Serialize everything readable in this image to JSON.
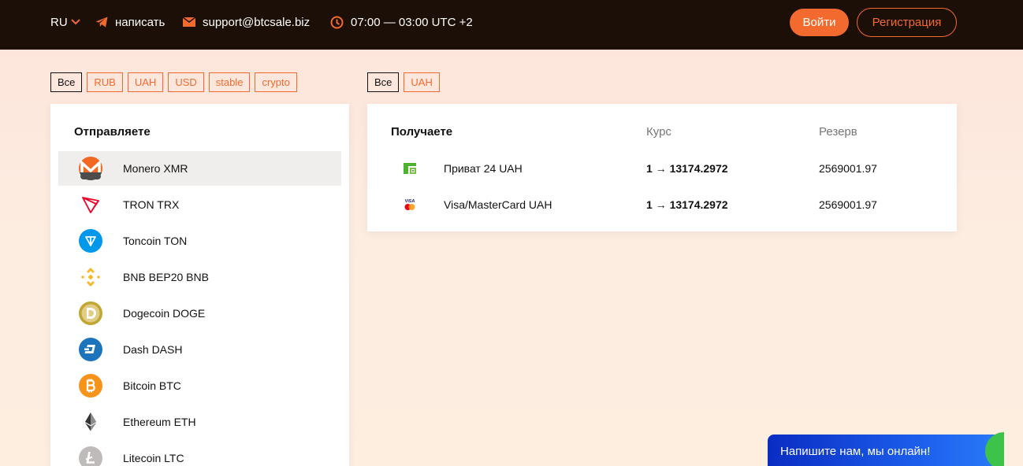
{
  "header": {
    "lang": "RU",
    "write_label": "написать",
    "email": "support@btcsale.biz",
    "hours": "07:00 — 03:00 UTC +2",
    "login_label": "Войти",
    "register_label": "Регистрация"
  },
  "send_filters": [
    "Все",
    "RUB",
    "UAH",
    "USD",
    "stable",
    "crypto"
  ],
  "recv_filters": [
    "Все",
    "UAH"
  ],
  "send_panel": {
    "title": "Отправляете",
    "coins": [
      {
        "label": "Monero XMR",
        "icon": "monero-icon",
        "color": "#f26822"
      },
      {
        "label": "TRON TRX",
        "icon": "tron-icon",
        "color": "#eb0029"
      },
      {
        "label": "Toncoin TON",
        "icon": "toncoin-icon",
        "color": "#0098ea"
      },
      {
        "label": "BNB BEP20 BNB",
        "icon": "bnb-icon",
        "color": "#f3ba2f"
      },
      {
        "label": "Dogecoin DOGE",
        "icon": "dogecoin-icon",
        "color": "#c2a633"
      },
      {
        "label": "Dash DASH",
        "icon": "dash-icon",
        "color": "#1c75bc"
      },
      {
        "label": "Bitcoin BTC",
        "icon": "bitcoin-icon",
        "color": "#f7931a"
      },
      {
        "label": "Ethereum ETH",
        "icon": "ethereum-icon",
        "color": "#343434"
      },
      {
        "label": "Litecoin LTC",
        "icon": "litecoin-icon",
        "color": "#bfbbbb"
      }
    ]
  },
  "recv_panel": {
    "title": "Получаете",
    "col_rate": "Курс",
    "col_reserve": "Резерв",
    "rows": [
      {
        "name": "Приват 24 UAH",
        "icon": "privat24-icon",
        "rate": "1 → 13174.2972",
        "reserve": "2569001.97"
      },
      {
        "name": "Visa/MasterCard UAH",
        "icon": "visa-mastercard-icon",
        "rate": "1 → 13174.2972",
        "reserve": "2569001.97"
      }
    ]
  },
  "chat": {
    "text": "Напишите нам, мы онлайн!"
  },
  "colors": {
    "accent": "#f26a2e",
    "topbar": "#1c0f08"
  }
}
